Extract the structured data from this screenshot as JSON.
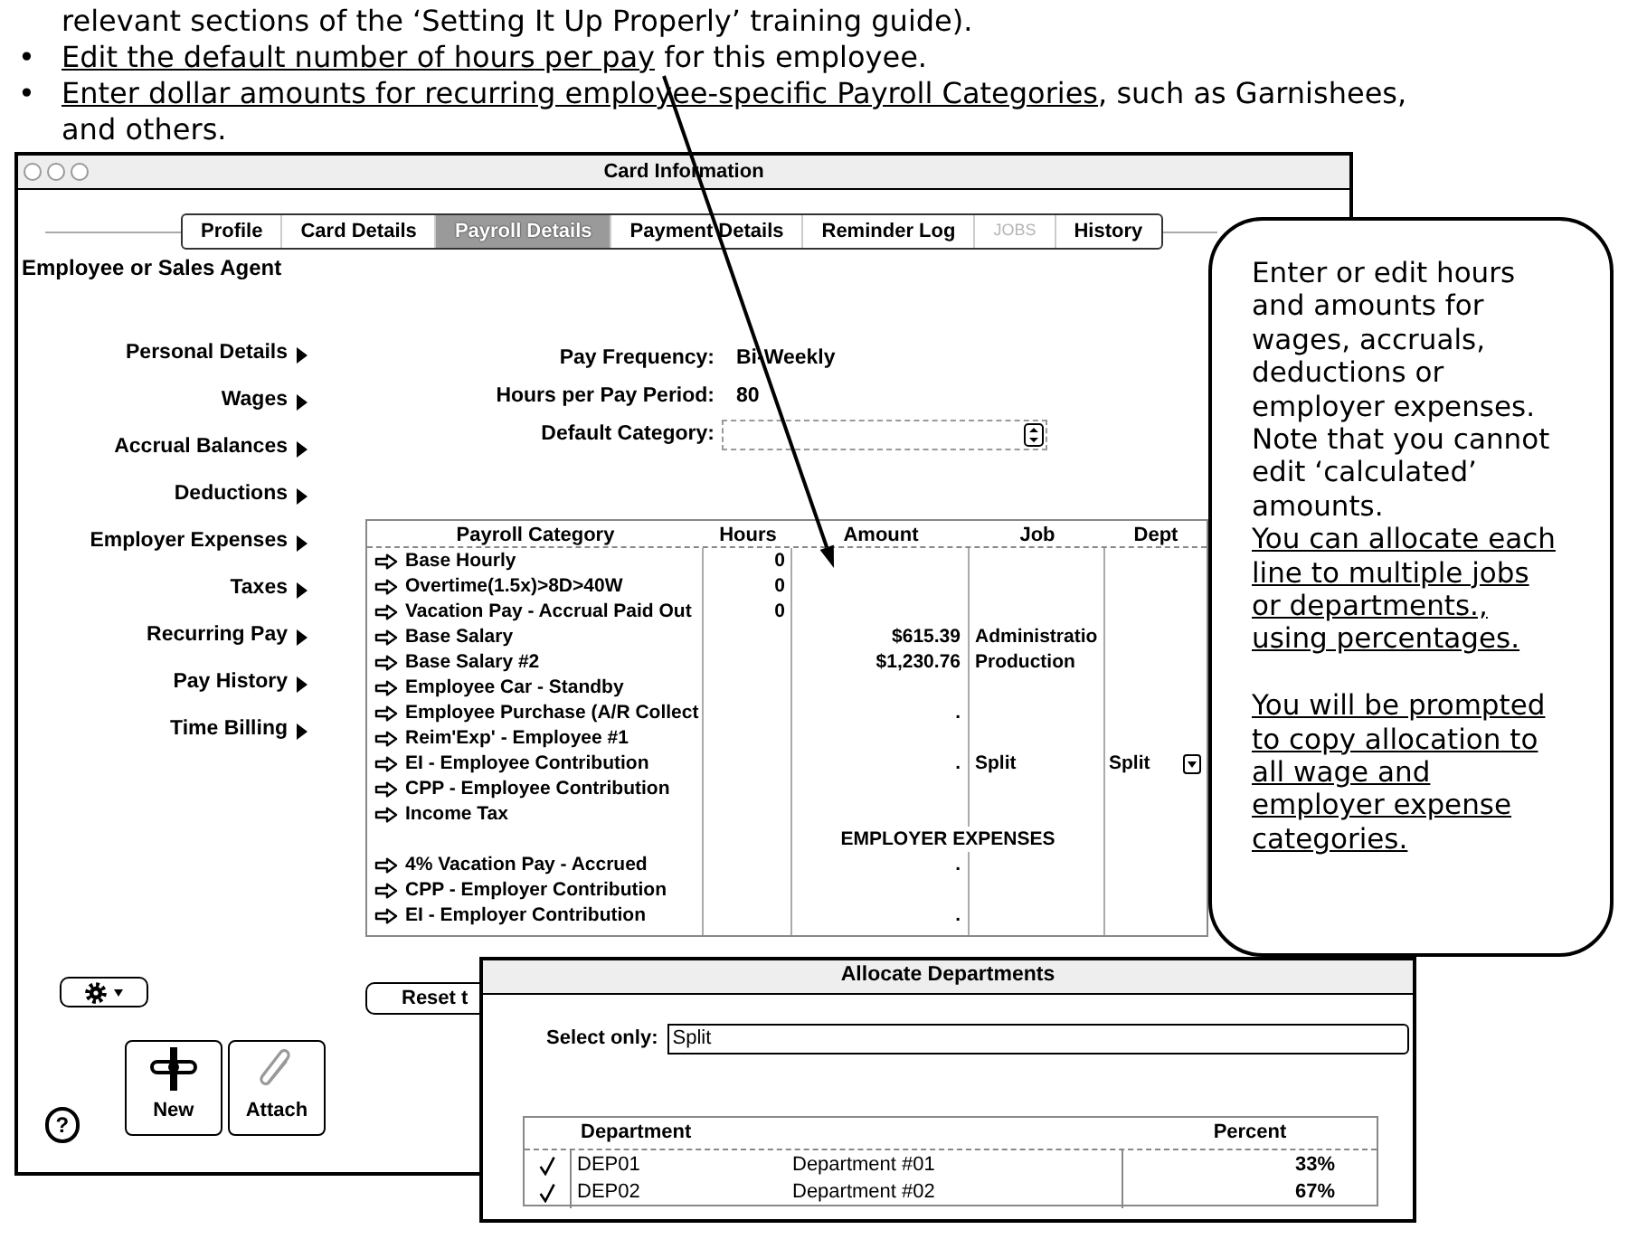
{
  "instructions": {
    "continuation": "relevant sections of the ‘Setting It Up Properly’ training guide).",
    "bullets": [
      {
        "marker": "•",
        "segments": [
          {
            "text": "Edit the default number of hours per pay",
            "link": true
          },
          {
            "text": " for this employee.",
            "link": false
          }
        ]
      },
      {
        "marker": "•",
        "segments": [
          {
            "text": "Enter dollar amounts for recurring employee-specific Payroll Categories",
            "link": true
          },
          {
            "text": ", such as Garnishees, and others.",
            "link": false
          }
        ]
      }
    ]
  },
  "window": {
    "title": "Card Information",
    "tabs": [
      {
        "label": "Profile",
        "selected": false,
        "disabled": false
      },
      {
        "label": "Card Details",
        "selected": false,
        "disabled": false
      },
      {
        "label": "Payroll Details",
        "selected": true,
        "disabled": false
      },
      {
        "label": "Payment Details",
        "selected": false,
        "disabled": false
      },
      {
        "label": "Reminder Log",
        "selected": false,
        "disabled": false
      },
      {
        "label": "JOBS",
        "selected": false,
        "disabled": true
      },
      {
        "label": "History",
        "selected": false,
        "disabled": false
      }
    ],
    "heading": "Employee or Sales Agent",
    "nav": [
      "Personal Details",
      "Wages",
      "Accrual Balances",
      "Deductions",
      "Employer Expenses",
      "Taxes",
      "Recurring Pay",
      "Pay History",
      "Time Billing"
    ],
    "fields": [
      {
        "kind": "text",
        "label": "Pay Frequency:",
        "value": "Bi-Weekly"
      },
      {
        "kind": "text",
        "label": "Hours per Pay Period:",
        "value": "80"
      },
      {
        "kind": "dropdown",
        "label": "Default Category:"
      }
    ],
    "table": {
      "columns": [
        "Payroll Category",
        "Hours",
        "Amount",
        "Job",
        "Dept"
      ],
      "rows": [
        {
          "kind": "category",
          "name": "Base Hourly",
          "hours": "0",
          "dept_menu": false
        },
        {
          "kind": "category",
          "name": "Overtime(1.5x)>8D>40W",
          "hours": "0",
          "dept_menu": false
        },
        {
          "kind": "category",
          "name": "Vacation Pay - Accrual Paid Out",
          "hours": "0",
          "dept_menu": false
        },
        {
          "kind": "category",
          "name": "Base Salary",
          "amount": "$615.39",
          "job": "Administratio",
          "dept_menu": false
        },
        {
          "kind": "category",
          "name": "Base Salary #2",
          "amount": "$1,230.76",
          "job": "Production",
          "dept_menu": false
        },
        {
          "kind": "category",
          "name": "Employee Car - Standby",
          "dept_menu": false
        },
        {
          "kind": "category",
          "name": "Employee Purchase (A/R Collect",
          "amount": ".",
          "dept_menu": false
        },
        {
          "kind": "category",
          "name": "Reim'Exp' - Employee #1",
          "dept_menu": false
        },
        {
          "kind": "category",
          "name": "EI - Employee Contribution",
          "amount": ".",
          "job": "Split",
          "dept": "Split",
          "dept_menu": true
        },
        {
          "kind": "category",
          "name": "CPP - Employee Contribution",
          "dept_menu": false
        },
        {
          "kind": "category",
          "name": "Income Tax",
          "dept_menu": false
        },
        {
          "kind": "section",
          "label": "EMPLOYER EXPENSES"
        },
        {
          "kind": "category",
          "name": "4% Vacation Pay - Accrued",
          "amount": ".",
          "dept_menu": false
        },
        {
          "kind": "category",
          "name": "CPP - Employer Contribution",
          "dept_menu": false
        },
        {
          "kind": "category",
          "name": "EI - Employer Contribution",
          "amount": ".",
          "dept_menu": false
        }
      ]
    },
    "reset_button": "Reset t",
    "new_button": "New",
    "attach_button": "Attach",
    "help_button": "?"
  },
  "callout": {
    "groups": [
      [
        {
          "text": "Enter or edit hours and amounts for wages, accruals, deductions or employer expenses. Note that you cannot edit ‘calculated’ amounts.",
          "underlined": false
        },
        {
          "text": "You can allocate each line to multiple jobs or departments., using percentages.",
          "underlined": true
        }
      ],
      [
        {
          "text": "You will be prompted to copy allocation to all wage and employer expense categories.",
          "underlined": true
        }
      ]
    ]
  },
  "dialog": {
    "title": "Allocate Departments",
    "filter": {
      "label": "Select only:",
      "value": "Split"
    },
    "columns": [
      "Department",
      "Percent"
    ],
    "rows": [
      {
        "checked": true,
        "code": "DEP01",
        "name": "Department #01",
        "percent": "33%"
      },
      {
        "checked": true,
        "code": "DEP02",
        "name": "Department #02",
        "percent": "67%"
      }
    ]
  }
}
